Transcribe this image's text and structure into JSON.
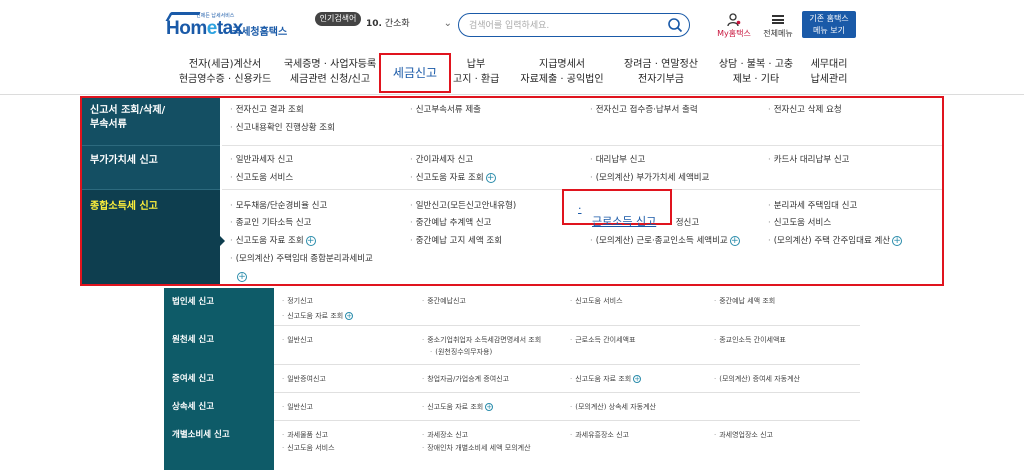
{
  "header": {
    "logo_text_a": "Hom",
    "logo_text_e": "e",
    "logo_text_b": "tax",
    "logo_tagline": "언제든 납세서비스",
    "logo_subtitle": "국세청홈택스",
    "popular_badge": "인기검색어",
    "popular_num": "10.",
    "popular_term": "간소화",
    "search_placeholder": "검색어를 입력하세요.",
    "my_hometax": "My홈택스",
    "all_menu": "전체메뉴",
    "classic_line1": "기존 홈택스",
    "classic_line2": "메뉴 보기"
  },
  "nav": [
    {
      "line1": "전자(세금)계산서",
      "line2": "현금영수증 · 신용카드"
    },
    {
      "line1": "국세증명 · 사업자등록",
      "line2": "세금관련 신청/신고"
    },
    {
      "line1": "세금신고",
      "line2": ""
    },
    {
      "line1": "납부",
      "line2": "고지 · 환급"
    },
    {
      "line1": "지급명세서",
      "line2": "자료제출 · 공익법인"
    },
    {
      "line1": "장려금 · 연말정산",
      "line2": "전자기부금"
    },
    {
      "line1": "상담 · 불복 · 고충",
      "line2": "제보 · 기타"
    },
    {
      "line1": "세무대리",
      "line2": "납세관리"
    }
  ],
  "mega": {
    "rows": [
      {
        "head_line1": "신고서 조회/삭제/",
        "head_line2": "부속서류",
        "items": [
          "전자신고 결과 조회",
          "신고부속서류 제출",
          "전자신고 접수증·납부서 출력",
          "전자신고 삭제 요청",
          "신고내용확인 진행상황 조회"
        ]
      },
      {
        "head_line1": "부가가치세 신고",
        "items": [
          "일반과세자 신고",
          "간이과세자 신고",
          "대리납부 신고",
          "카드사 대리납부 신고",
          "신고도움 서비스",
          "신고도움 자료 조회",
          "(모의계산) 부가가치세 세액비교"
        ]
      },
      {
        "head_line1": "종합소득세 신고",
        "items": [
          "모두채움/단순경비율 신고",
          "일반신고(모든신고안내유형)",
          "근로소득 신고",
          "분리과세 주택임대 신고",
          "종교인 기타소득 신고",
          "중간예납 추계액 신고",
          "정신고",
          "신고도움 서비스",
          "신고도움 자료 조회",
          "중간예납 고지 세액 조회",
          "(모의계산) 근로·종교인소득 세액비교",
          "(모의계산) 주택 간주임대료 계산",
          "(모의계산) 주택임대 종합분리과세비교"
        ]
      }
    ]
  },
  "lower": [
    {
      "head": "법인세 신고",
      "items": [
        "정기신고",
        "중간예납신고",
        "신고도움 서비스",
        "중간예납 세액 조회",
        "신고도움 자료 조회"
      ]
    },
    {
      "head": "원천세 신고",
      "items": [
        "일반신고",
        "중소기업취업자 소득세감면명세서 조회",
        "(원천징수의무자용)",
        "근로소득 간이세액표",
        "종교인소득 간이세액표"
      ]
    },
    {
      "head": "증여세 신고",
      "items": [
        "일반증여신고",
        "창업자금/가업승계 증여신고",
        "신고도움 자료 조회",
        "(모의계산) 증여세 자동계산"
      ]
    },
    {
      "head": "상속세 신고",
      "items": [
        "일반신고",
        "신고도움 자료 조회",
        "(모의계산) 상속세 자동계산"
      ]
    },
    {
      "head": "개별소비세 신고",
      "items": [
        "과세물품 신고",
        "과세장소 신고",
        "과세유흥장소 신고",
        "과세영업장소 신고",
        "신고도움 서비스",
        "장애인차 개별소비세 세액 모의계산"
      ]
    }
  ]
}
